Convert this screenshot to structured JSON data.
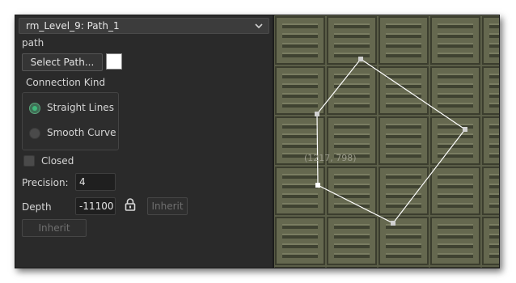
{
  "header": {
    "title": "rm_Level_9: Path_1"
  },
  "path_section": {
    "label": "path",
    "select_button": "Select Path...",
    "color_swatch": "#ffffff"
  },
  "connection": {
    "label": "Connection Kind",
    "options": [
      {
        "label": "Straight Lines",
        "selected": true
      },
      {
        "label": "Smooth Curve",
        "selected": false
      }
    ]
  },
  "closed": {
    "label": "Closed",
    "checked": false
  },
  "precision": {
    "label": "Precision:",
    "value": "4"
  },
  "depth": {
    "label": "Depth",
    "value": "-11100",
    "inherit_label": "Inherit"
  },
  "inherit_button": "Inherit",
  "canvas": {
    "coordinate_readout": "(1217, 798)"
  },
  "colors": {
    "panel_bg": "#2a2a2a",
    "accent_green": "#3fb87a",
    "path_line": "#ffffff"
  },
  "icons": {
    "dropdown": "chevron-down-icon",
    "lock": "lock-icon"
  }
}
